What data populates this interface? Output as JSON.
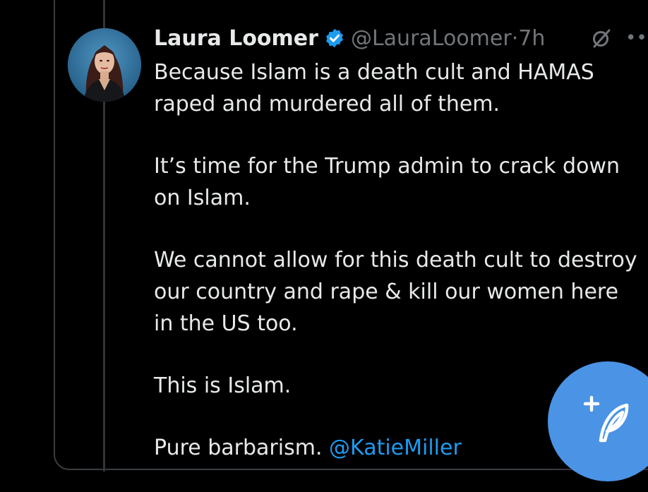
{
  "tweet": {
    "author_name": "Laura Loomer",
    "handle": "@LauraLoomer",
    "separator": "·",
    "time": "7h",
    "paragraphs": [
      "Because Islam is a death cult and HAMAS raped and murdered all of them.",
      "It’s time for the Trump admin to crack down on Islam.",
      "We cannot allow for this death cult to destroy our country and rape & kill our women here in the US too.",
      "This is Islam."
    ],
    "last_line_text": "Pure barbarism.",
    "mention": "@KatieMiller"
  },
  "icons": {
    "verified": "verified-badge-icon",
    "grok": "grok-icon",
    "more": "more-icon",
    "compose": "compose-post-icon"
  },
  "colors": {
    "background": "#000000",
    "text": "#e7e9ea",
    "secondary_text": "#71767b",
    "link": "#1d9bf0",
    "fab": "#4a93e5"
  }
}
